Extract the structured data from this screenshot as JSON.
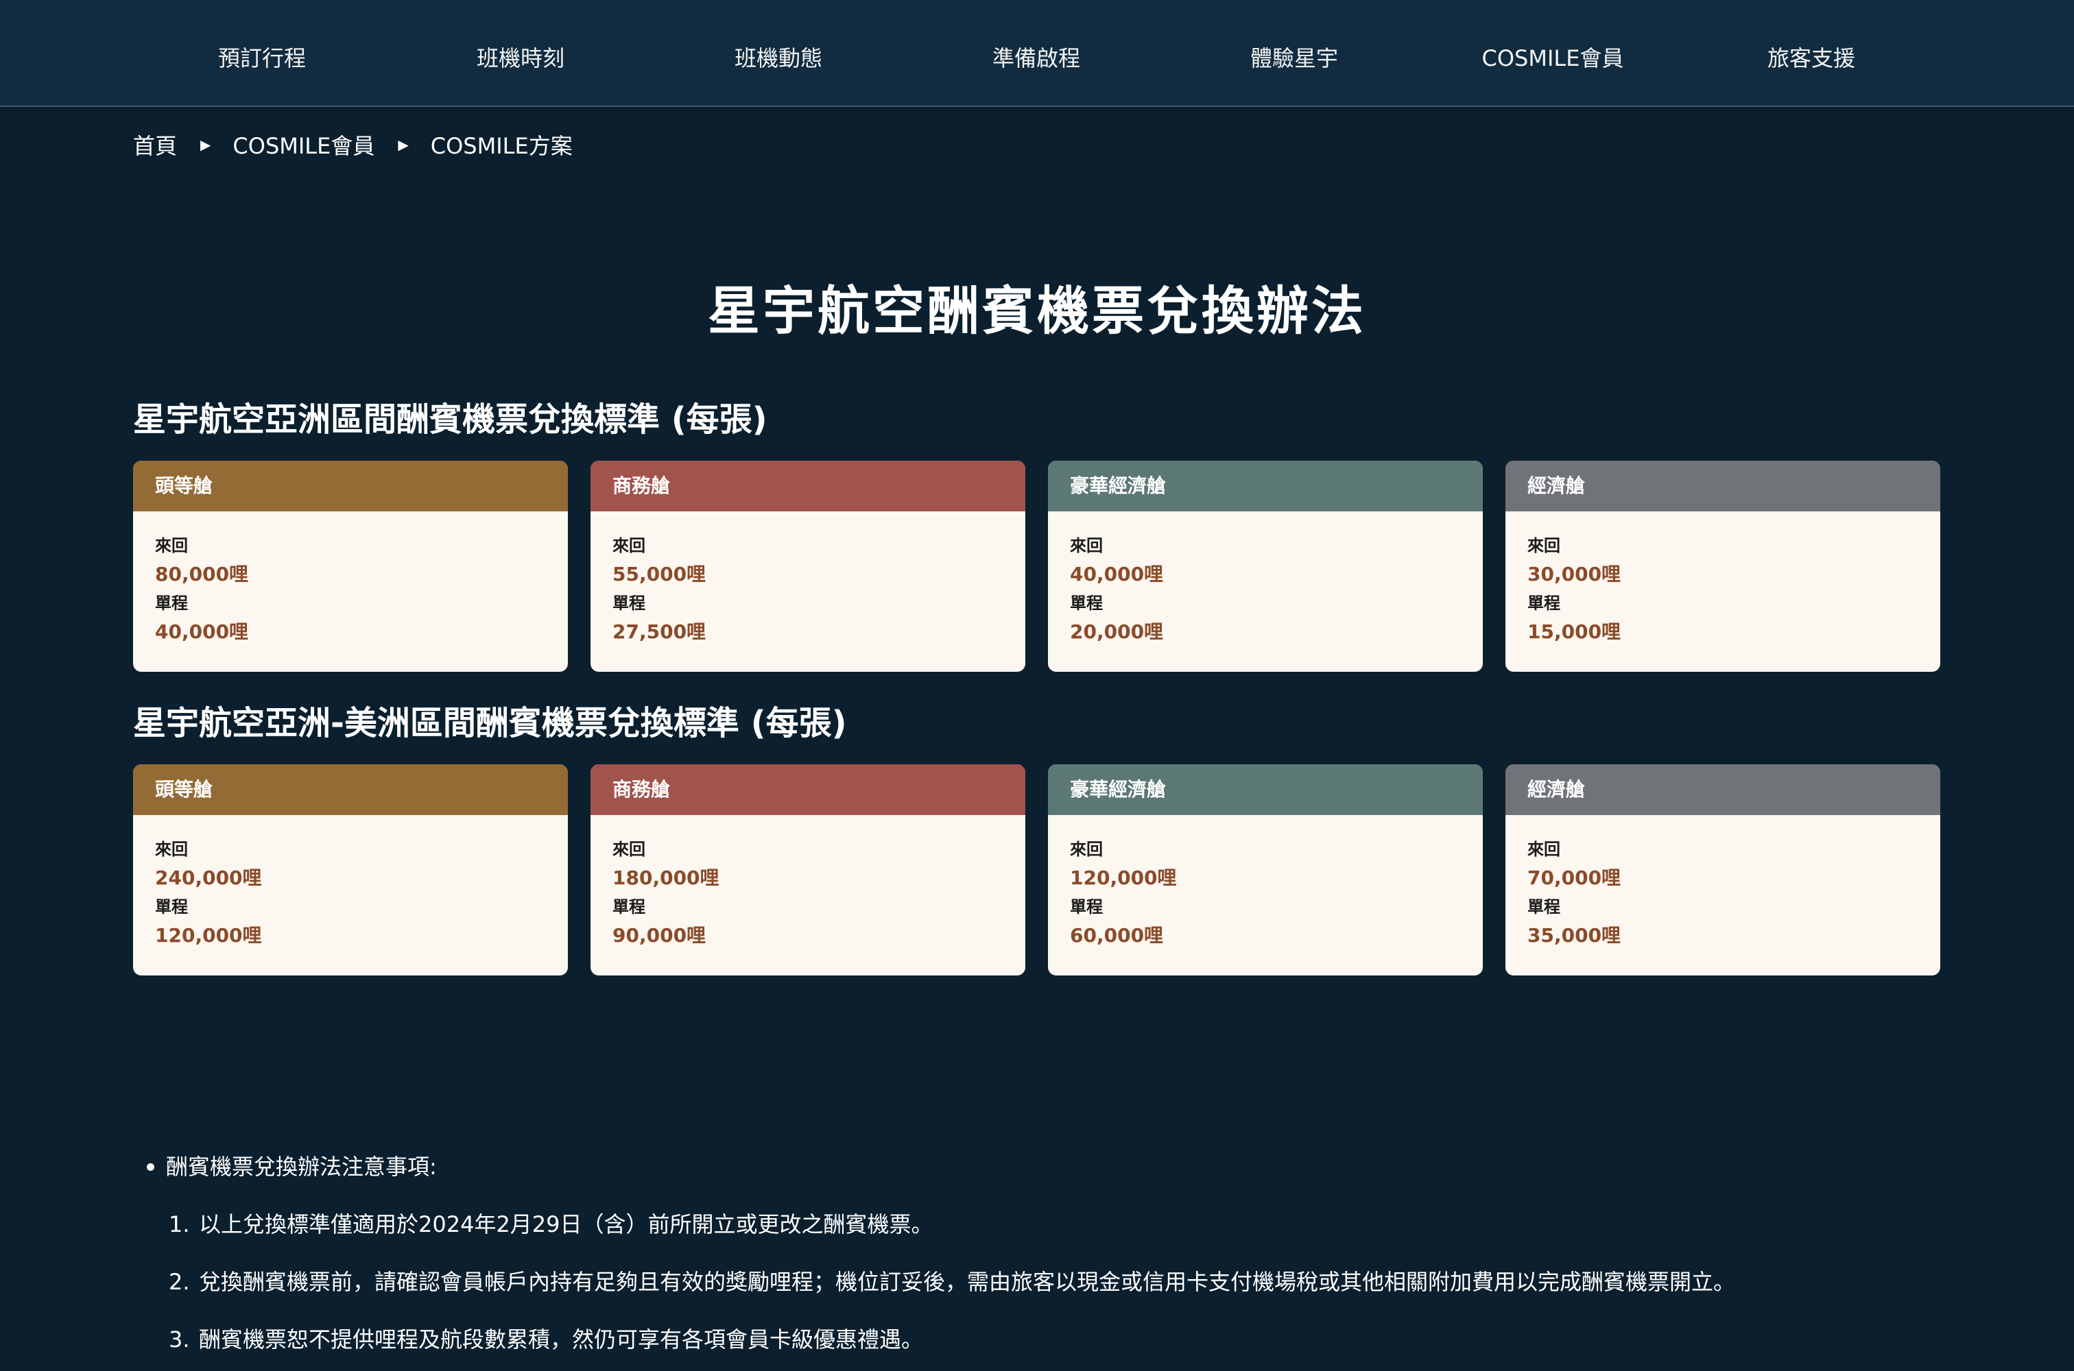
{
  "nav": {
    "items": [
      "預訂行程",
      "班機時刻",
      "班機動態",
      "準備啟程",
      "體驗星宇",
      "COSMILE會員",
      "旅客支援"
    ]
  },
  "breadcrumb": {
    "items": [
      "首頁",
      "COSMILE會員",
      "COSMILE方案"
    ],
    "separator": "▶"
  },
  "page": {
    "title": "星宇航空酬賓機票兌換辦法"
  },
  "colors": {
    "first": "#946b35",
    "business": "#a0544b",
    "premium": "#5c7875",
    "economy": "#707378"
  },
  "sections": [
    {
      "title": "星宇航空亞洲區間酬賓機票兌換標準 (每張)",
      "cards": [
        {
          "cabin": "頭等艙",
          "roundtrip_label": "來回",
          "roundtrip": "80,000哩",
          "oneway_label": "單程",
          "oneway": "40,000哩"
        },
        {
          "cabin": "商務艙",
          "roundtrip_label": "來回",
          "roundtrip": "55,000哩",
          "oneway_label": "單程",
          "oneway": "27,500哩"
        },
        {
          "cabin": "豪華經濟艙",
          "roundtrip_label": "來回",
          "roundtrip": "40,000哩",
          "oneway_label": "單程",
          "oneway": "20,000哩"
        },
        {
          "cabin": "經濟艙",
          "roundtrip_label": "來回",
          "roundtrip": "30,000哩",
          "oneway_label": "單程",
          "oneway": "15,000哩"
        }
      ]
    },
    {
      "title": "星宇航空亞洲-美洲區間酬賓機票兌換標準 (每張)",
      "cards": [
        {
          "cabin": "頭等艙",
          "roundtrip_label": "來回",
          "roundtrip": "240,000哩",
          "oneway_label": "單程",
          "oneway": "120,000哩"
        },
        {
          "cabin": "商務艙",
          "roundtrip_label": "來回",
          "roundtrip": "180,000哩",
          "oneway_label": "單程",
          "oneway": "90,000哩"
        },
        {
          "cabin": "豪華經濟艙",
          "roundtrip_label": "來回",
          "roundtrip": "120,000哩",
          "oneway_label": "單程",
          "oneway": "60,000哩"
        },
        {
          "cabin": "經濟艙",
          "roundtrip_label": "來回",
          "roundtrip": "70,000哩",
          "oneway_label": "單程",
          "oneway": "35,000哩"
        }
      ]
    }
  ],
  "notes": {
    "heading": "酬賓機票兌換辦法注意事項:",
    "items": [
      {
        "num": "1.",
        "text": "以上兌換標準僅適用於2024年2月29日（含）前所開立或更改之酬賓機票。"
      },
      {
        "num": "2.",
        "text": "兌換酬賓機票前，請確認會員帳戶內持有足夠且有效的獎勵哩程；機位訂妥後，需由旅客以現金或信用卡支付機場稅或其他相關附加費用以完成酬賓機票開立。"
      },
      {
        "num": "3.",
        "text": "酬賓機票恕不提供哩程及航段數累積，然仍可享有各項會員卡級優惠禮遇。"
      }
    ]
  }
}
